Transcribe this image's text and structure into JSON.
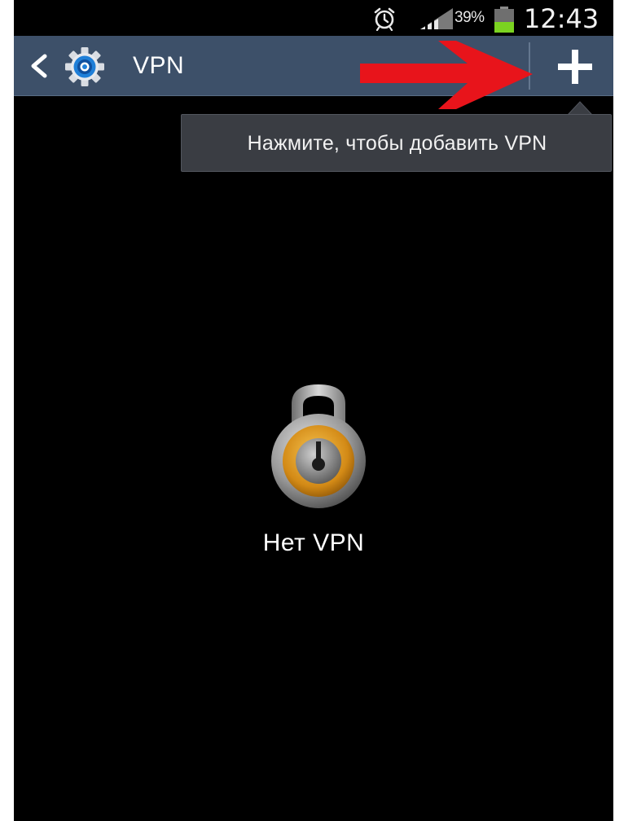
{
  "status_bar": {
    "alarm_icon": "alarm-clock-icon",
    "signal_icon": "signal-strength-icon",
    "battery_percent": "39%",
    "battery_icon": "battery-icon",
    "time": "12:43"
  },
  "action_bar": {
    "back_icon": "chevron-left-icon",
    "app_icon": "settings-gear-icon",
    "title": "VPN",
    "add_icon": "plus-icon"
  },
  "tooltip": {
    "text": "Нажмите, чтобы добавить VPN"
  },
  "empty_state": {
    "icon": "padlock-icon",
    "label": "Нет VPN"
  },
  "colors": {
    "action_bar_bg": "#3d5069",
    "background": "#000000",
    "tooltip_bg": "#3a3d43",
    "annotation_arrow": "#e8141b",
    "battery_level": "#7bd321",
    "lock_ring": "#d38a16"
  }
}
